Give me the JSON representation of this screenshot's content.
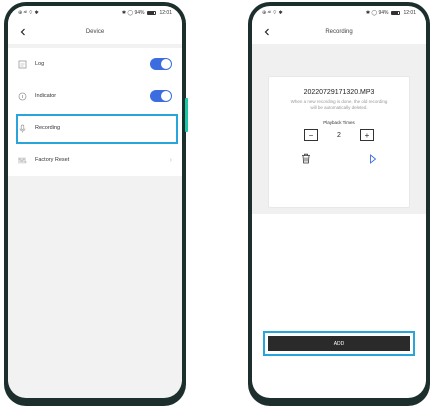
{
  "status_bar": {
    "left_icons": "⊕ ᵃˡˡ ⌔ ✱",
    "right_text": "✱ ◯ 94%",
    "time": "12:01"
  },
  "left_screen": {
    "title": "Device",
    "items": [
      {
        "label": "Log",
        "icon": "log-icon",
        "control": "toggle",
        "on": true
      },
      {
        "label": "Indicator",
        "icon": "info-icon",
        "control": "toggle",
        "on": true
      },
      {
        "label": "Recording",
        "icon": "microphone-icon",
        "control": "none",
        "highlighted": true
      },
      {
        "label": "Factory Reset",
        "icon": "reset-icon",
        "control": "chevron"
      }
    ]
  },
  "right_screen": {
    "title": "Recording",
    "file_name": "20220729171320.MP3",
    "hint": "When a new recording is done, the old recording will be automatically deleted.",
    "playback_label": "Playback Times",
    "playback_value": "2",
    "minus": "−",
    "plus": "+",
    "add_label": "ADD"
  },
  "colors": {
    "toggle_on": "#3b6de0",
    "highlight": "#2aa5dc",
    "phone_frame": "#1c2f2d",
    "accent_edge": "#18c9a8"
  }
}
